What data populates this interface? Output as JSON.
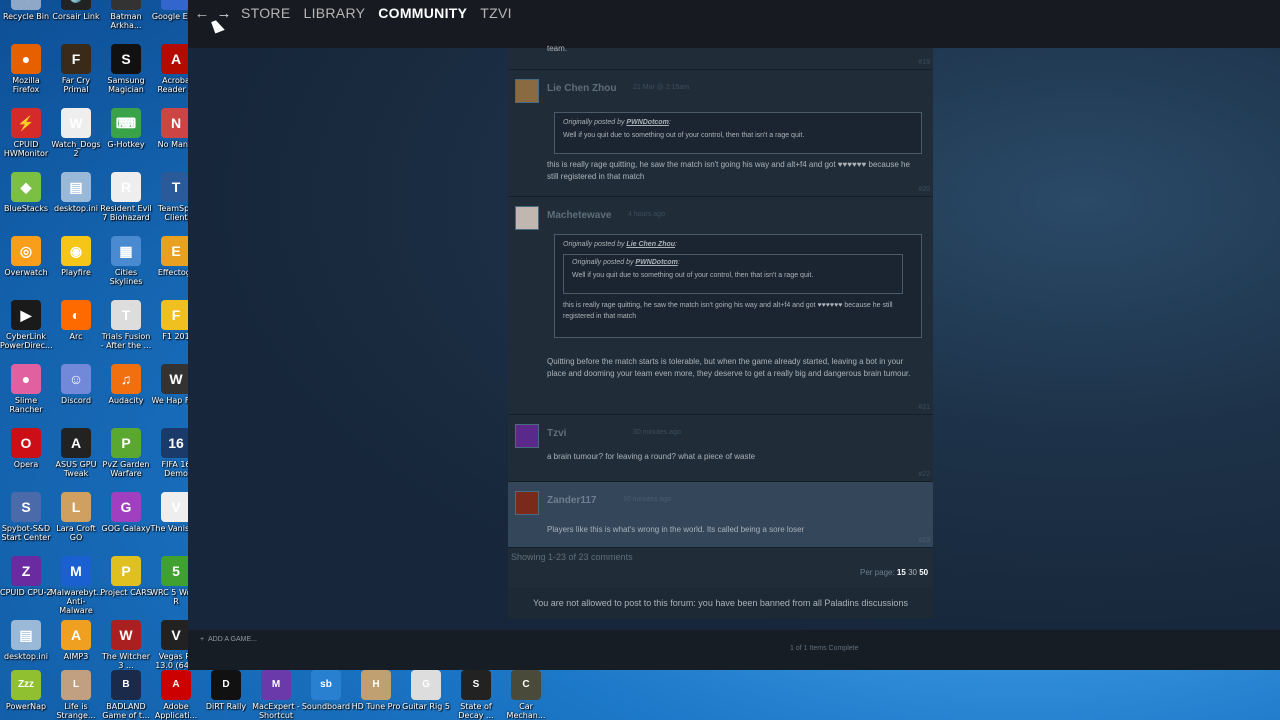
{
  "desktop": {
    "icons": [
      {
        "label": "Recycle Bin",
        "icon": "recycle-bin-icon",
        "color": "#8fa8c8",
        "glyph": "♻"
      },
      {
        "label": "Corsair Link",
        "icon": "corsair-icon",
        "color": "#222222",
        "glyph": "⚓"
      },
      {
        "label": "Batman Arkha...",
        "icon": "batman-icon",
        "color": "#333333",
        "glyph": "B"
      },
      {
        "label": "Google Ea...",
        "icon": "google-earth-icon",
        "color": "#3366cc",
        "glyph": "G"
      },
      {
        "label": "Mozilla Firefox",
        "icon": "firefox-icon",
        "color": "#e66000",
        "glyph": "●"
      },
      {
        "label": "Far Cry Primal",
        "icon": "farcry-icon",
        "color": "#3a2a1a",
        "glyph": "F"
      },
      {
        "label": "Samsung Magician",
        "icon": "samsung-icon",
        "color": "#111111",
        "glyph": "S"
      },
      {
        "label": "Acroba Reader D",
        "icon": "acrobat-icon",
        "color": "#b30b00",
        "glyph": "A"
      },
      {
        "label": "CPUID HWMonitor",
        "icon": "hwmonitor-icon",
        "color": "#d42a2a",
        "glyph": "⚡"
      },
      {
        "label": "Watch_Dogs 2",
        "icon": "watchdogs-icon",
        "color": "#eeeeee",
        "glyph": "W"
      },
      {
        "label": "G-Hotkey",
        "icon": "keyboard-icon",
        "color": "#3aa34a",
        "glyph": "⌨"
      },
      {
        "label": "No Man's",
        "icon": "nomans-icon",
        "color": "#cc4444",
        "glyph": "N"
      },
      {
        "label": "BlueStacks",
        "icon": "bluestacks-icon",
        "color": "#7bc043",
        "glyph": "◆"
      },
      {
        "label": "desktop.ini",
        "icon": "file-icon",
        "color": "#9ab8d8",
        "glyph": "▤"
      },
      {
        "label": "Resident Evil 7 Biohazard",
        "icon": "re7-icon",
        "color": "#eeeeee",
        "glyph": "R"
      },
      {
        "label": "TeamSpe Client",
        "icon": "teamspeak-icon",
        "color": "#2a5a9a",
        "glyph": "T"
      },
      {
        "label": "Overwatch",
        "icon": "overwatch-icon",
        "color": "#f99e1a",
        "glyph": "◎"
      },
      {
        "label": "Playfire",
        "icon": "playfire-icon",
        "color": "#f5c518",
        "glyph": "◉"
      },
      {
        "label": "Cities Skylines",
        "icon": "cities-icon",
        "color": "#4a8ad0",
        "glyph": "▦"
      },
      {
        "label": "Effectogr",
        "icon": "effecto-icon",
        "color": "#e8a020",
        "glyph": "E"
      },
      {
        "label": "CyberLink PowerDirec...",
        "icon": "cyberlink-icon",
        "color": "#1a1a1a",
        "glyph": "▶"
      },
      {
        "label": "Arc",
        "icon": "arc-icon",
        "color": "#ff6a00",
        "glyph": "◐"
      },
      {
        "label": "Trials Fusion - After the ...",
        "icon": "trials-icon",
        "color": "#dddddd",
        "glyph": "T"
      },
      {
        "label": "F1 201",
        "icon": "f1-icon",
        "color": "#f0c020",
        "glyph": "F"
      },
      {
        "label": "Slime Rancher",
        "icon": "slime-icon",
        "color": "#e060a0",
        "glyph": "●"
      },
      {
        "label": "Discord",
        "icon": "discord-icon",
        "color": "#7289da",
        "glyph": "☺"
      },
      {
        "label": "Audacity",
        "icon": "audacity-icon",
        "color": "#f07010",
        "glyph": "♫"
      },
      {
        "label": "We Hap Few",
        "icon": "wehappy-icon",
        "color": "#333333",
        "glyph": "W"
      },
      {
        "label": "Opera",
        "icon": "opera-icon",
        "color": "#cc0f16",
        "glyph": "O"
      },
      {
        "label": "ASUS GPU Tweak",
        "icon": "asus-icon",
        "color": "#222222",
        "glyph": "A"
      },
      {
        "label": "PvZ Garden Warfare",
        "icon": "pvz-icon",
        "color": "#5aa830",
        "glyph": "P"
      },
      {
        "label": "FIFA 16 Demo",
        "icon": "fifa-icon",
        "color": "#1a3a6a",
        "glyph": "16"
      },
      {
        "label": "Spybot-S&D Start Center",
        "icon": "spybot-icon",
        "color": "#4a6aaa",
        "glyph": "S"
      },
      {
        "label": "Lara Croft GO",
        "icon": "laracroft-icon",
        "color": "#d0a060",
        "glyph": "L"
      },
      {
        "label": "GOG Galaxy",
        "icon": "gog-icon",
        "color": "#a040c0",
        "glyph": "G"
      },
      {
        "label": "The Vanishin",
        "icon": "vanishing-icon",
        "color": "#eeeeee",
        "glyph": "V"
      },
      {
        "label": "CPUID CPU-Z",
        "icon": "cpuz-icon",
        "color": "#6a2aa0",
        "glyph": "Z"
      },
      {
        "label": "Malwarebyt... Anti-Malware",
        "icon": "malwarebytes-icon",
        "color": "#1a60d0",
        "glyph": "M"
      },
      {
        "label": "Project CARS",
        "icon": "projectcars-icon",
        "color": "#e0c020",
        "glyph": "P"
      },
      {
        "label": "WRC 5 World R",
        "icon": "wrc-icon",
        "color": "#40a030",
        "glyph": "5"
      },
      {
        "label": "desktop.ini",
        "icon": "file-icon",
        "color": "#9ab8d8",
        "glyph": "▤"
      },
      {
        "label": "AIMP3",
        "icon": "aimp-icon",
        "color": "#f0a020",
        "glyph": "A"
      },
      {
        "label": "The Witcher 3 ...",
        "icon": "witcher-icon",
        "color": "#aa2020",
        "glyph": "W"
      },
      {
        "label": "Vegas Pr 13.0 (64-b",
        "icon": "vegas-icon",
        "color": "#222222",
        "glyph": "V"
      }
    ],
    "taskbar_icons": [
      {
        "label": "PowerNap",
        "icon": "powernap-icon",
        "color": "#90c030",
        "glyph": "Zzz"
      },
      {
        "label": "Life is Strange...",
        "icon": "lifeisstrange-icon",
        "color": "#c0a080",
        "glyph": "L"
      },
      {
        "label": "BADLAND Game of t...",
        "icon": "badland-icon",
        "color": "#1a2a4a",
        "glyph": "B"
      },
      {
        "label": "Adobe Applicati...",
        "icon": "adobe-icon",
        "color": "#cc0000",
        "glyph": "A"
      },
      {
        "label": "DiRT Rally",
        "icon": "dirt-icon",
        "color": "#111111",
        "glyph": "D"
      },
      {
        "label": "MacExpert - Shortcut",
        "icon": "macexpert-icon",
        "color": "#6a3aaa",
        "glyph": "M"
      },
      {
        "label": "Soundboard",
        "icon": "soundboard-icon",
        "color": "#2a80d0",
        "glyph": "sb"
      },
      {
        "label": "HD Tune Pro",
        "icon": "hdtune-icon",
        "color": "#c0a070",
        "glyph": "H"
      },
      {
        "label": "Guitar Rig 5",
        "icon": "guitarrig-icon",
        "color": "#dddddd",
        "glyph": "G"
      },
      {
        "label": "State of Decay ...",
        "icon": "stateofdecay-icon",
        "color": "#222222",
        "glyph": "S"
      },
      {
        "label": "Car Mechan...",
        "icon": "carmechanic-icon",
        "color": "#4a4a3a",
        "glyph": "C"
      }
    ]
  },
  "steam": {
    "menu": [
      "STORE",
      "LIBRARY",
      "COMMUNITY",
      "TZVI"
    ],
    "active_menu": "COMMUNITY",
    "posts": [
      {
        "id": "p19",
        "body_prev": "team.",
        "num": "#19"
      },
      {
        "id": "p20",
        "author": "Lie Chen Zhou",
        "time": "21 Mar @ 2:15am",
        "quote_head_prefix": "Originally posted by ",
        "quote_author": "PWNDotcom",
        "quote_text": "Well if you quit due to something out of your control, then that isn't a rage quit.",
        "body": "this is really rage quitting, he saw the match isn't going his way and alt+f4 and got ♥♥♥♥♥♥ because he still registered in that match",
        "num": "#20"
      },
      {
        "id": "p21",
        "author": "Machetewave",
        "time": "4 hours ago",
        "quote_head_prefix": "Originally posted by ",
        "quote_author": "Lie Chen Zhou",
        "inner_quote_head_prefix": "Originally posted by ",
        "inner_quote_author": "PWNDotcom",
        "inner_quote_text": "Well if you quit due to something out of your control, then that isn't a rage quit.",
        "quote_text": "this is really rage quitting, he saw the match isn't going his way and alt+f4 and got ♥♥♥♥♥♥ because he still registered in that match",
        "body": "Quitting before the match starts is tolerable, but when the game already started, leaving a bot in your place and dooming your team even more, they deserve to get a really big and dangerous brain tumour.",
        "num": "#21"
      },
      {
        "id": "p22",
        "author": "Tzvi",
        "time": "30 minutes ago",
        "body": "a brain tumour? for leaving a round? what a piece of waste",
        "num": "#22"
      },
      {
        "id": "p23",
        "author": "Zander117",
        "time": "10 minutes ago",
        "body": "Players like this is what's wrong in the world. Its called being a sore loser",
        "num": "#23"
      }
    ],
    "showing": "Showing 1-23 of 23 comments",
    "per_page_label": "Per page: ",
    "per_page_options": [
      "15",
      "30",
      "50"
    ],
    "per_page_current": "15",
    "banned_notice": "You are not allowed to post to this forum: you have been banned from all Paladins discussions",
    "add_game": "ADD A GAME...",
    "download_status": "1 of 1 Items Complete"
  }
}
